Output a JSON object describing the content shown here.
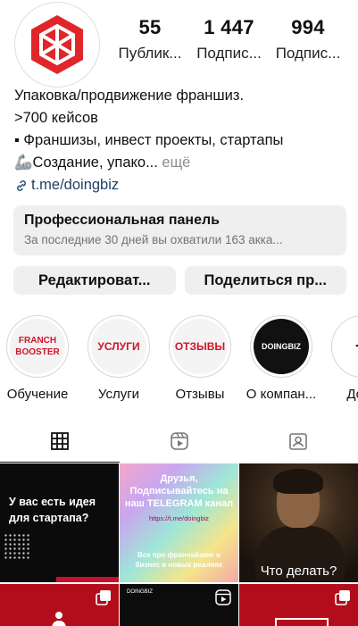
{
  "profile": {
    "stats": [
      {
        "value": "55",
        "label": "Публик..."
      },
      {
        "value": "1 447",
        "label": "Подпис..."
      },
      {
        "value": "994",
        "label": "Подпис..."
      }
    ],
    "bio": {
      "name": "Упаковка/продвижение франшиз.",
      "line1": ">700 кейсов",
      "line2": "▪ Франшизы, инвест проекты, стартапы",
      "line3_text": "🦾Создание, упако...",
      "line3_more": "ещё",
      "link": "t.me/doingbiz"
    },
    "brand_color": "#E0262B"
  },
  "pro_panel": {
    "title": "Профессиональная панель",
    "subtitle": "За последние 30 дней вы охватили 163 акка..."
  },
  "actions": {
    "edit_label": "Редактироват...",
    "share_label": "Поделиться пр..."
  },
  "highlights": [
    {
      "label": "Обучение",
      "cover_text": "FRANCH BOOSTER"
    },
    {
      "label": "Услуги",
      "cover_text": "УСЛУГИ"
    },
    {
      "label": "Отзывы",
      "cover_text": "ОТЗЫВЫ"
    },
    {
      "label": "О компан...",
      "cover_text": "DOINGBIZ"
    },
    {
      "label": "Доба",
      "cover_text": "+"
    }
  ],
  "tabs": [
    {
      "name": "grid",
      "icon": "grid-icon",
      "active": true
    },
    {
      "name": "reels",
      "icon": "reels-icon",
      "active": false
    },
    {
      "name": "tagged",
      "icon": "tagged-icon",
      "active": false
    }
  ],
  "posts": {
    "p1_text": "У вас есть идея для стартапа?",
    "p2_title": "Друзья, Подписывайтесь на наш TELEGRAM канал",
    "p2_link": "https://t.me/doingbiz",
    "p2_body": "Все про франчайзинг и бизнес в новых реалиях",
    "p3_caption": "Что делать?",
    "p5_mini": "DOINGBIZ"
  }
}
